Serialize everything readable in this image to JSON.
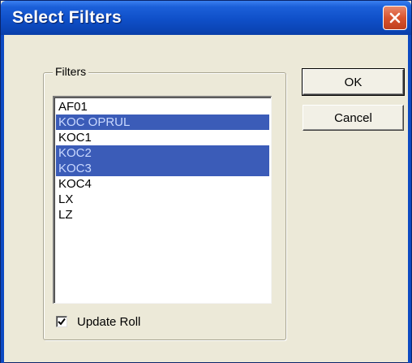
{
  "window": {
    "title": "Select Filters"
  },
  "group": {
    "label": "Filters"
  },
  "filters": {
    "items": [
      {
        "label": "AF01",
        "selected": false
      },
      {
        "label": "KOC OPRUL",
        "selected": true
      },
      {
        "label": "KOC1",
        "selected": false
      },
      {
        "label": "KOC2",
        "selected": true
      },
      {
        "label": "KOC3",
        "selected": true
      },
      {
        "label": "KOC4",
        "selected": false
      },
      {
        "label": "LX",
        "selected": false
      },
      {
        "label": "LZ",
        "selected": false
      }
    ]
  },
  "options": {
    "update_roll_label": "Update Roll",
    "update_roll_checked": true
  },
  "buttons": {
    "ok_label": "OK",
    "cancel_label": "Cancel"
  },
  "colors": {
    "selection": "#3b5cb8",
    "titlebar": "#0f4fc8",
    "face": "#ece9d8"
  }
}
